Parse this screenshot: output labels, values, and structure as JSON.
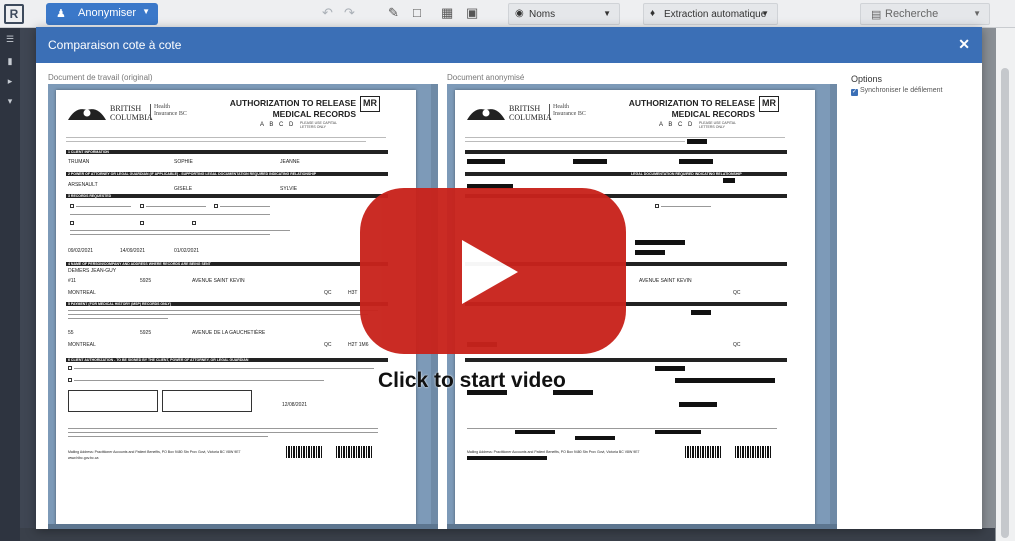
{
  "toolbar": {
    "user_label": "Anonymiser",
    "names_label": "Noms",
    "extraction_label": "Extraction automatique",
    "search_label": "Recherche"
  },
  "modal": {
    "title": "Comparaison cote à cote",
    "left_label": "Document de travail (original)",
    "right_label": "Document anonymisé"
  },
  "options": {
    "title": "Options",
    "sync_scroll_label": "Synchroniser le défilement",
    "sync_scroll_checked": true
  },
  "document": {
    "org_line1": "BRITISH",
    "org_line2": "COLUMBIA",
    "health_line1": "Health",
    "health_line2": "Insurance BC",
    "title_line1": "AUTHORIZATION TO RELEASE",
    "title_line2": "MEDICAL RECORDS",
    "mr_box": "MR",
    "abcd": "A B C D",
    "please_use": "PLEASE USE CAPITAL LETTERS ONLY",
    "sec1": "1  CLIENT INFORMATION",
    "sec2": "2  POWER OF ATTORNEY OR LEGAL GUARDIAN (IF APPLICABLE) - SUPPORTING LEGAL DOCUMENTATION REQUIRED INDICATING RELATIONSHIP",
    "sec3": "3  RECORDS REQUESTED",
    "sec4": "4  NAME OF PERSON/COMPANY AND ADDRESS WHERE RECORDS ARE BEING SENT",
    "sec5": "5  PAYMENT (FOR MEDICAL HISTORY (MSP) RECORDS ONLY)",
    "sec6": "6  CLIENT AUTHORIZATION - TO BE SIGNED BY THE CLIENT, POWER OF ATTORNEY, OR LEGAL GUARDIAN",
    "orig_values": {
      "last_name": "TRUMAN",
      "first_name": "SOPHIE",
      "second_name": "JEANNE",
      "poa_last": "ARSENAULT",
      "poa_first": "GISELE",
      "poa_second": "SYLVIE",
      "requested_date": "09/02/2021",
      "from_date": "14/09/2021",
      "to_date": "01/02/2021",
      "recipient": "DEMERS JEAN-GUY",
      "unit": "#11",
      "street_no": "5925",
      "street": "AVENUE SAINT KEVIN",
      "city": "MONTREAL",
      "prov": "QC",
      "postal": "H3T",
      "pay_no": "55",
      "pay_street_no": "5925",
      "pay_street": "AVENUE DE LA GAUCHETIÈRE",
      "pay_city": "MONTREAL",
      "pay_prov": "QC",
      "pay_postal": "H2T 1M6",
      "sig_date": "12/08/2021"
    },
    "anon_values": {
      "street": "AVENUE SAINT KEVIN",
      "prov": "QC"
    },
    "footer": "Mailing Address: Practitioner Accounts and Patient Benefits, PO Box 9480 Stn Prov Govt, Victoria BC  V8W 9E7",
    "website": "www.hibc.gov.bc.ca"
  },
  "video": {
    "caption": "Click to start video"
  },
  "colors": {
    "accent": "#3b6fb6",
    "play": "#c8231c",
    "sidebar": "#2e3440"
  }
}
